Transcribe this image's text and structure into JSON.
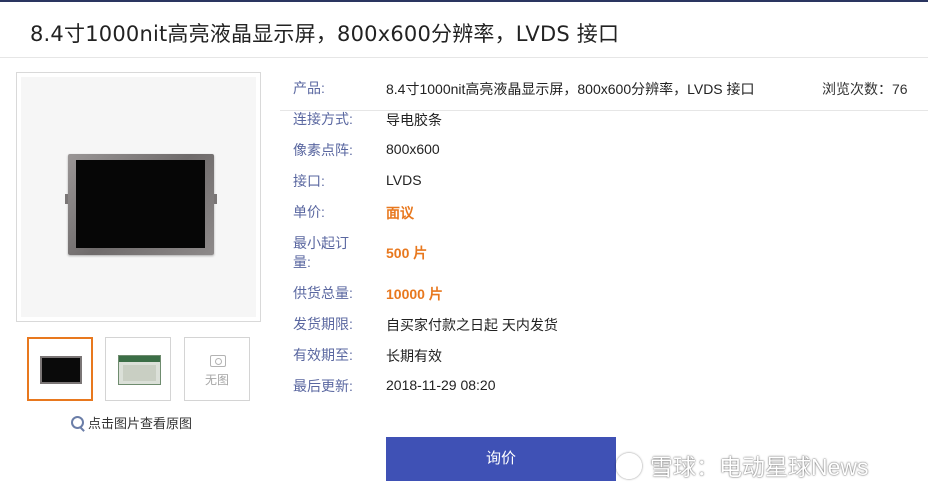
{
  "title": "8.4寸1000nit高亮液晶显示屏，800x600分辨率，LVDS 接口",
  "views": {
    "label": "浏览次数：",
    "count": "76"
  },
  "details": [
    {
      "label": "产品:",
      "value": "8.4寸1000nit高亮液晶显示屏，800x600分辨率，LVDS 接口"
    },
    {
      "label": "连接方式:",
      "value": "导电胶条"
    },
    {
      "label": "像素点阵:",
      "value": "800x600"
    },
    {
      "label": "接口:",
      "value": "LVDS"
    },
    {
      "label": "单价:",
      "value": "面议"
    },
    {
      "label": "最小起订量:",
      "value": "500 片"
    },
    {
      "label": "供货总量:",
      "value": "10000 片"
    },
    {
      "label": "发货期限:",
      "value": "自买家付款之日起 天内发货"
    },
    {
      "label": "有效期至:",
      "value": "长期有效"
    },
    {
      "label": "最后更新:",
      "value": "2018-11-29 08:20"
    }
  ],
  "gallery": {
    "no_image_label": "无图",
    "zoom_hint": "点击图片查看原图"
  },
  "inquire_button": "询价",
  "watermark": "雪球：电动星球News",
  "colors": {
    "accent": "#3f51b5",
    "highlight": "#e8781e",
    "label": "#5a67a0"
  }
}
